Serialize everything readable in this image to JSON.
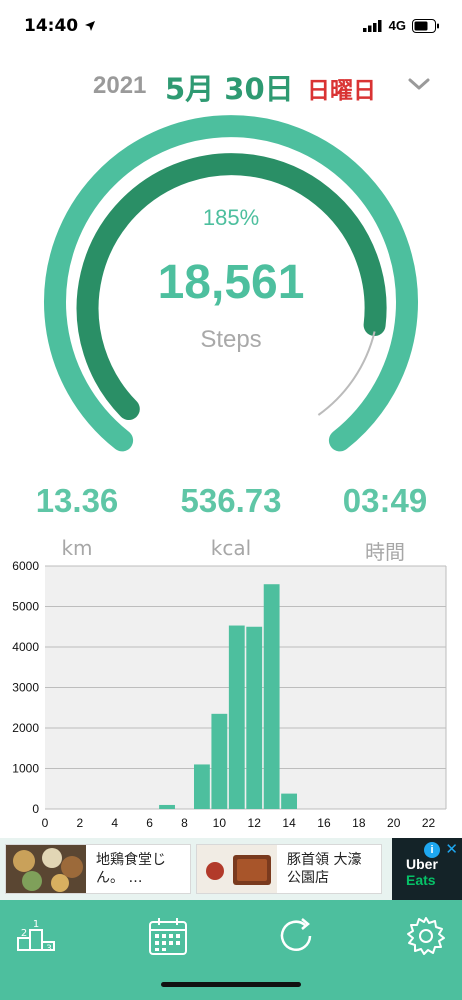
{
  "status": {
    "time": "14:40",
    "network": "4G"
  },
  "date": {
    "year": "2021",
    "month_day": "5月 30日",
    "weekday": "日曜日"
  },
  "progress": {
    "percent_label": "185%",
    "fraction": 1.85,
    "steps": "18,561",
    "steps_label": "Steps"
  },
  "stats": [
    {
      "value": "13.36",
      "unit": "km"
    },
    {
      "value": "536.73",
      "unit": "kcal"
    },
    {
      "value": "03:49",
      "unit": "時間"
    }
  ],
  "chart_data": {
    "type": "bar",
    "title": "",
    "xlabel": "",
    "ylabel": "",
    "xlim": [
      0,
      23
    ],
    "ylim": [
      0,
      6000
    ],
    "y_ticks": [
      "0",
      "1000",
      "2000",
      "3000",
      "4000",
      "5000",
      "6000"
    ],
    "x_ticks": [
      "0",
      "2",
      "4",
      "6",
      "8",
      "10",
      "12",
      "14",
      "16",
      "18",
      "20",
      "22"
    ],
    "grid": true,
    "color": "#4dbf9e",
    "series": [
      {
        "x": [
          7,
          9,
          10,
          11,
          12,
          13,
          14
        ],
        "values": [
          100,
          1100,
          2350,
          4530,
          4500,
          5550,
          380
        ]
      }
    ]
  },
  "ad": {
    "card1_text": "地鶏食堂じん。 …",
    "card2_text": "豚首領 大濠公園店",
    "brand_line1": "Uber",
    "brand_line2": "Eats",
    "info_label": "i",
    "close_label": "✕"
  },
  "tabs": [
    "ranking-icon",
    "calendar-icon",
    "refresh-icon",
    "settings-icon"
  ],
  "colors": {
    "accent": "#4dbf9e",
    "accent_dark": "#2a8f66",
    "date_green": "#2e9a72",
    "weekday_red": "#d93333"
  }
}
